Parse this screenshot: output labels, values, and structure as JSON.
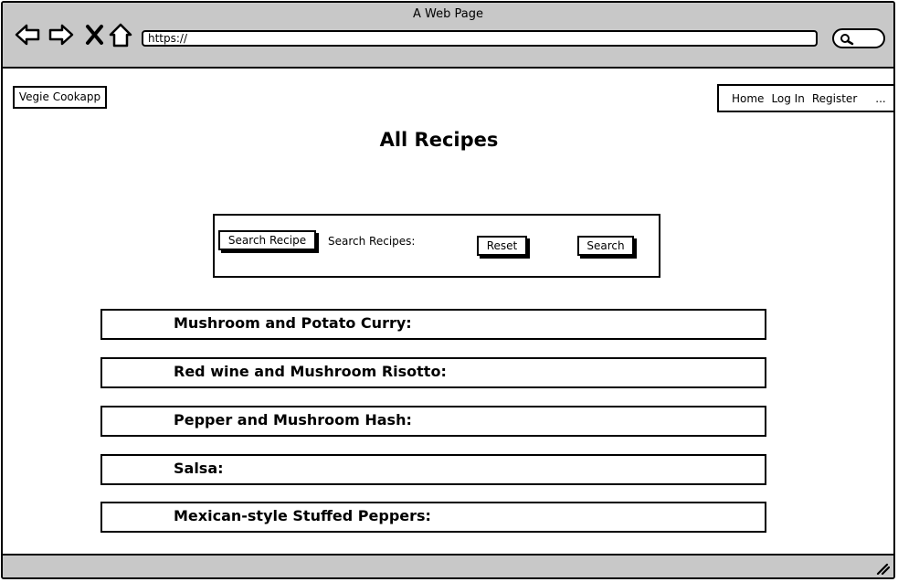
{
  "window": {
    "title": "A Web Page"
  },
  "browser": {
    "url": "https://"
  },
  "icons": {
    "back": "back-arrow-icon",
    "forward": "forward-arrow-icon",
    "close": "close-icon",
    "home": "home-icon",
    "search": "search-icon",
    "resize": "resize-grip-icon"
  },
  "header": {
    "logo": "Vegie Cookapp",
    "nav": [
      "Home",
      "Log In",
      "Register",
      "..."
    ]
  },
  "page": {
    "title": "All Recipes"
  },
  "search": {
    "search_recipe_label": "Search Recipe",
    "field_label": "Search Recipes:",
    "reset_label": "Reset",
    "search_label": "Search"
  },
  "recipes": [
    "Mushroom and Potato Curry:",
    "Red wine and Mushroom Risotto:",
    "Pepper and Mushroom Hash:",
    "Salsa:",
    "Mexican-style Stuffed Peppers:"
  ],
  "colors": {
    "chrome": "#c8c8c8",
    "border": "#000000",
    "background": "#ffffff"
  }
}
